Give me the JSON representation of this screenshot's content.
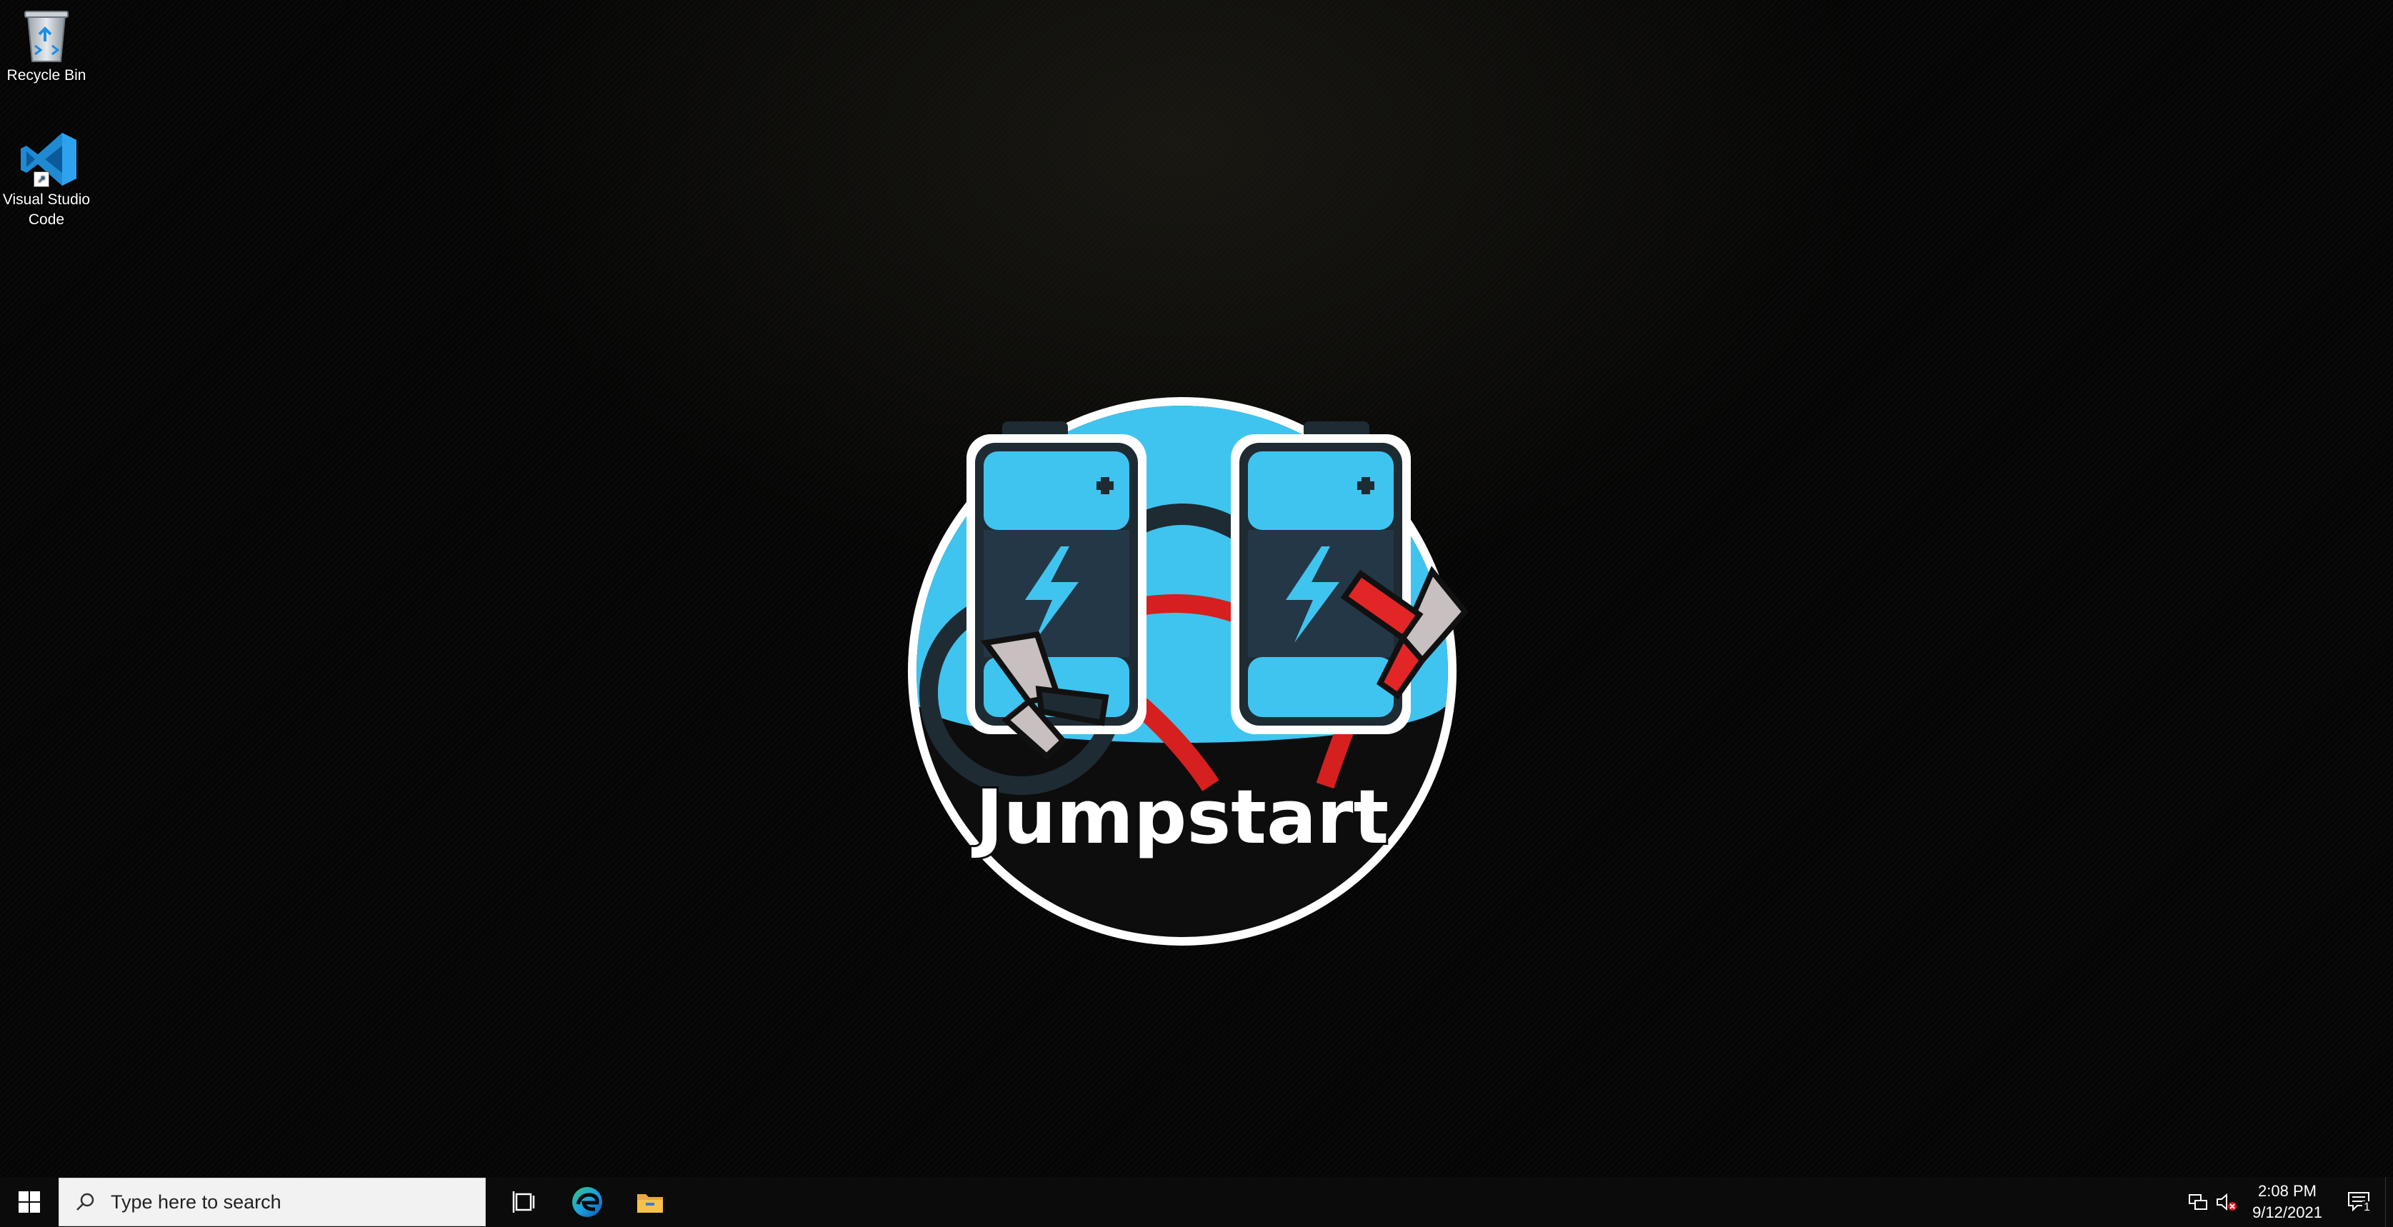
{
  "desktop": {
    "icons": [
      {
        "label": "Recycle Bin",
        "icon": "recycle-bin-icon"
      },
      {
        "label": "Visual Studio Code",
        "icon": "vscode-icon"
      }
    ],
    "wallpaper": {
      "logo_text": "Jumpstart",
      "colors": {
        "battery": "#3fc4f0",
        "dark": "#1f2a33",
        "cable_red": "#d61f1f",
        "clamp_gray": "#c8c0c0",
        "ring": "#ffffff"
      }
    }
  },
  "taskbar": {
    "start_icon": "windows-logo-icon",
    "search": {
      "placeholder": "Type here to search",
      "icon": "search-icon"
    },
    "pinned": [
      {
        "name": "Task View",
        "icon": "task-view-icon"
      },
      {
        "name": "Microsoft Edge",
        "icon": "edge-icon"
      },
      {
        "name": "File Explorer",
        "icon": "folder-icon"
      }
    ],
    "tray": {
      "network_icon": "network-icon",
      "volume_icon": "volume-muted-icon",
      "time": "2:08 PM",
      "date": "9/12/2021",
      "notification_count": "1"
    }
  }
}
